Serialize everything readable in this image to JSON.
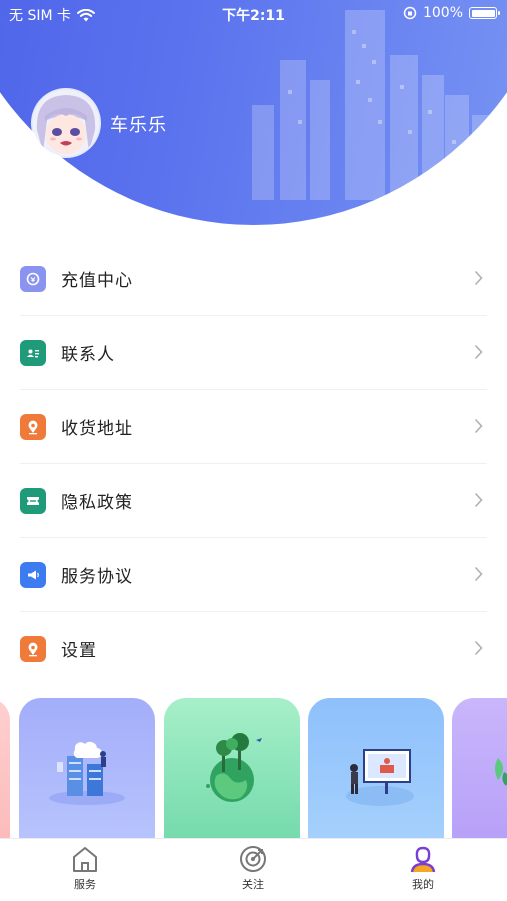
{
  "status_bar": {
    "carrier": "无 SIM 卡",
    "time": "下午2:11",
    "battery": "100%"
  },
  "profile": {
    "username": "车乐乐"
  },
  "menu": {
    "items": [
      {
        "label": "充值中心",
        "icon": "recharge-icon",
        "color": "#8a93f0"
      },
      {
        "label": "联系人",
        "icon": "contact-card-icon",
        "color": "#1f9b7a"
      },
      {
        "label": "收货地址",
        "icon": "location-pin-icon",
        "color": "#f07a3a"
      },
      {
        "label": "隐私政策",
        "icon": "ticket-icon",
        "color": "#1f9b7a"
      },
      {
        "label": "服务协议",
        "icon": "megaphone-icon",
        "color": "#3d7cf0"
      },
      {
        "label": "设置",
        "icon": "location-pin-icon",
        "color": "#f07a3a"
      }
    ]
  },
  "cards": [
    {
      "name": "cloud-server-card",
      "color": "#a9b6fb"
    },
    {
      "name": "green-earth-card",
      "color": "#7fdcae"
    },
    {
      "name": "presentation-card",
      "color": "#8ec4fb"
    }
  ],
  "tabbar": {
    "tabs": [
      {
        "label": "服务",
        "icon": "home-icon",
        "active": false
      },
      {
        "label": "关注",
        "icon": "target-icon",
        "active": false
      },
      {
        "label": "我的",
        "icon": "user-icon",
        "active": true
      }
    ],
    "active_color": "#7a3fd0"
  }
}
